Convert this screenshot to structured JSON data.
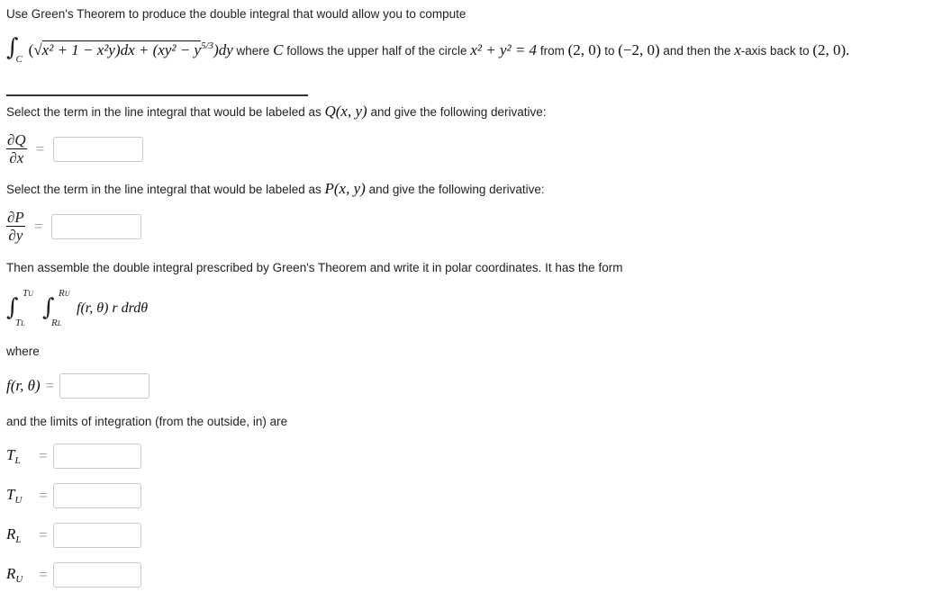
{
  "intro": "Use Green's Theorem to produce the double integral that would allow you to compute",
  "line_integral": {
    "contour_sub": "C",
    "integrand_p": "x² + 1 − x²y)dx + (xy² − y",
    "exp": "5/3",
    "tail": ")dy",
    "where_text": "where",
    "curve_sym": "C",
    "follows_text": "follows the upper half of the circle",
    "circle_eq": "x² + y² = 4",
    "from_text": "from",
    "pt1": "(2, 0)",
    "to_text": "to",
    "pt2": "(−2, 0)",
    "and_then_text": "and then the",
    "axis_var": "x",
    "axis_back_text": "-axis back to",
    "pt3": "(2, 0)."
  },
  "q_prompt": {
    "before": "Select the term in the line integral that would be labeled as",
    "label": "Q(x, y)",
    "after": "and give the following derivative:"
  },
  "dq": {
    "num": "∂Q",
    "den": "∂x",
    "eq": "=",
    "value": ""
  },
  "p_prompt": {
    "before": "Select the term in the line integral that would be labeled as",
    "label": "P(x, y)",
    "after": "and give the following derivative:"
  },
  "dp": {
    "num": "∂P",
    "den": "∂y",
    "eq": "=",
    "value": ""
  },
  "assemble_text": "Then assemble the double integral prescribed by Green's Theorem and write it in polar coordinates. It has the form",
  "double_integral": {
    "outer_upper": "T",
    "outer_upper_sub": "U",
    "outer_lower": "T",
    "outer_lower_sub": "L",
    "inner_upper": "R",
    "inner_upper_sub": "U",
    "inner_lower": "R",
    "inner_lower_sub": "L",
    "integrand": "f(r, θ) r drdθ"
  },
  "where_text": "where",
  "f_field": {
    "label": "f(r, θ)",
    "eq": "=",
    "value": ""
  },
  "limits_text": "and the limits of integration (from the outside, in) are",
  "limits": [
    {
      "sym": "T",
      "sub": "L",
      "eq": "=",
      "value": ""
    },
    {
      "sym": "T",
      "sub": "U",
      "eq": "=",
      "value": ""
    },
    {
      "sym": "R",
      "sub": "L",
      "eq": "=",
      "value": ""
    },
    {
      "sym": "R",
      "sub": "U",
      "eq": "=",
      "value": ""
    }
  ]
}
